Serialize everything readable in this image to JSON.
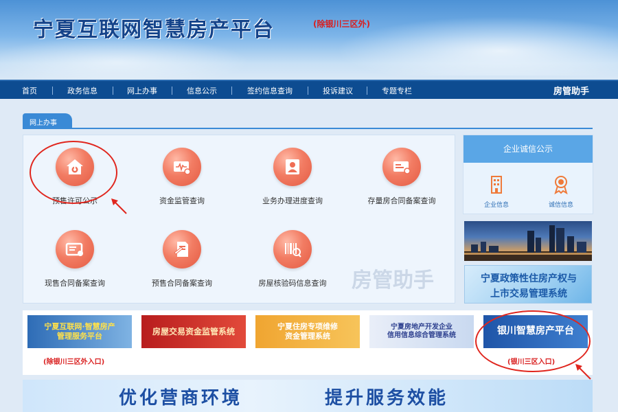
{
  "header": {
    "title": "宁夏互联网智慧房产平台",
    "subtitle": "(除银川三区外)"
  },
  "nav": {
    "items": [
      "首页",
      "政务信息",
      "网上办事",
      "信息公示",
      "签约信息查询",
      "投诉建议",
      "专题专栏"
    ],
    "right": "房管助手"
  },
  "section": {
    "tab": "网上办事",
    "watermark": "房管助手"
  },
  "services": [
    {
      "label": "预售许可公示",
      "icon": "house-icon"
    },
    {
      "label": "资金监管查询",
      "icon": "card-icon"
    },
    {
      "label": "业务办理进度查询",
      "icon": "id-card-icon"
    },
    {
      "label": "存量房合同备案查询",
      "icon": "contract-icon"
    },
    {
      "label": "现售合同备案查询",
      "icon": "certificate-icon"
    },
    {
      "label": "预售合同备案查询",
      "icon": "document-pen-icon"
    },
    {
      "label": "房屋核验码信息查询",
      "icon": "barcode-icon"
    }
  ],
  "credit": {
    "title": "企业诚信公示",
    "items": [
      {
        "label": "企业信息",
        "icon": "building-icon"
      },
      {
        "label": "诚信信息",
        "icon": "medal-icon"
      }
    ]
  },
  "policy_banner": {
    "line1": "宁夏政策性住房产权与",
    "line2": "上市交易管理系统"
  },
  "banners": [
    {
      "lines": [
        "宁夏互联网·智慧房产",
        "管理服务平台"
      ],
      "caption": "(除银川三区外入口)"
    },
    {
      "lines": [
        "房屋交易资金监管系统"
      ],
      "caption": ""
    },
    {
      "lines": [
        "宁夏住房专项维修",
        "资金管理系统"
      ],
      "caption": ""
    },
    {
      "lines": [
        "宁夏房地产开发企业",
        "信用信息综合管理系统"
      ],
      "caption": ""
    },
    {
      "lines": [
        "银川智慧房产平台"
      ],
      "caption": "(银川三区入口)"
    }
  ],
  "slogan": {
    "left": "优化营商环境",
    "right": "提升服务效能"
  },
  "colors": {
    "nav_bg": "#0d4c91",
    "accent_blue": "#3a8ad6",
    "icon_orange": "#f27c63",
    "annotation_red": "#e0261e"
  }
}
